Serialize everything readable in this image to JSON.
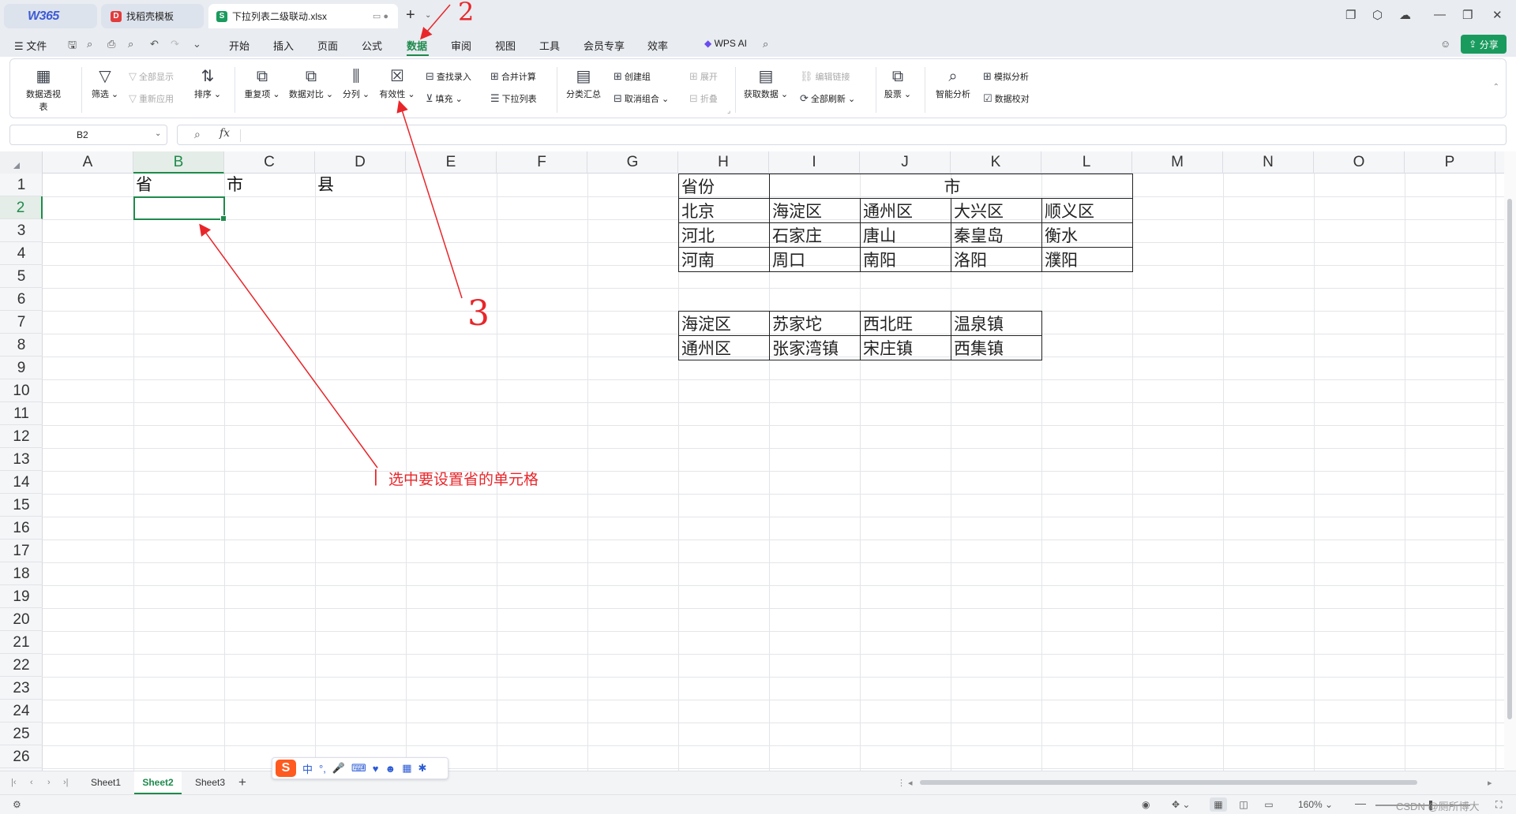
{
  "window": {
    "tabs": [
      {
        "label": "W365"
      },
      {
        "label": "找稻壳模板"
      },
      {
        "label": "下拉列表二级联动.xlsx"
      }
    ],
    "new_tab": "+",
    "controls": [
      "❐",
      "⬡",
      "☁",
      "—",
      "❐",
      "✕"
    ]
  },
  "menu": {
    "file": "文件",
    "items": [
      "开始",
      "插入",
      "页面",
      "公式",
      "数据",
      "审阅",
      "视图",
      "工具",
      "会员专享",
      "效率"
    ],
    "active": "数据",
    "wps_ai": "WPS AI",
    "share": "分享"
  },
  "ribbon": {
    "pivot": "数据透视表",
    "filter": "筛选",
    "show_all": "全部显示",
    "reapply": "重新应用",
    "sort": "排序",
    "duplicates": "重复项",
    "compare": "数据对比",
    "split": "分列",
    "validity": "有效性",
    "lookup": "查找录入",
    "fill": "填充",
    "consolidate": "合并计算",
    "dropdown": "下拉列表",
    "subtotal": "分类汇总",
    "group": "创建组",
    "ungroup": "取消组合",
    "expand": "展开",
    "collapse": "折叠",
    "get_data": "获取数据",
    "edit_links": "编辑链接",
    "refresh_all": "全部刷新",
    "stocks": "股票",
    "smart_analysis": "智能分析",
    "what_if": "模拟分析",
    "verify": "数据校对"
  },
  "formula_bar": {
    "name_box": "B2",
    "fx": "fx",
    "formula": ""
  },
  "columns": [
    "A",
    "B",
    "C",
    "D",
    "E",
    "F",
    "G",
    "H",
    "I",
    "J",
    "K",
    "L",
    "M",
    "N",
    "O",
    "P"
  ],
  "selected_column": "B",
  "rows": [
    "1",
    "2",
    "3",
    "4",
    "5",
    "6",
    "7",
    "8",
    "9",
    "10",
    "11",
    "12",
    "13",
    "14",
    "15",
    "16",
    "17",
    "18",
    "19",
    "20",
    "21",
    "22",
    "23",
    "24",
    "25",
    "26"
  ],
  "selected_row": "2",
  "headers_row1": {
    "B": "省",
    "C": "市",
    "D": "县"
  },
  "table1": {
    "header_province": "省份",
    "header_city": "市",
    "rows": [
      [
        "北京",
        "海淀区",
        "通州区",
        "大兴区",
        "顺义区"
      ],
      [
        "河北",
        "石家庄",
        "唐山",
        "秦皇岛",
        "衡水"
      ],
      [
        "河南",
        "周口",
        "南阳",
        "洛阳",
        "濮阳"
      ]
    ]
  },
  "table2": {
    "rows": [
      [
        "海淀区",
        "苏家坨",
        "西北旺",
        "温泉镇"
      ],
      [
        "通州区",
        "张家湾镇",
        "宋庄镇",
        "西集镇"
      ]
    ]
  },
  "annotations": {
    "note_select_cell": "选中要设置省的单元格",
    "step2": "2",
    "step3": "3",
    "bar_mark": "|"
  },
  "sheets": [
    "Sheet1",
    "Sheet2",
    "Sheet3"
  ],
  "active_sheet": "Sheet2",
  "status": {
    "zoom": "160%",
    "watermark": "CSDN @厕所博大"
  },
  "ime": {
    "lang": "中"
  },
  "colors": {
    "accent": "#1f8a4c",
    "annotation": "#e8262a",
    "share": "#1a9b5e"
  }
}
